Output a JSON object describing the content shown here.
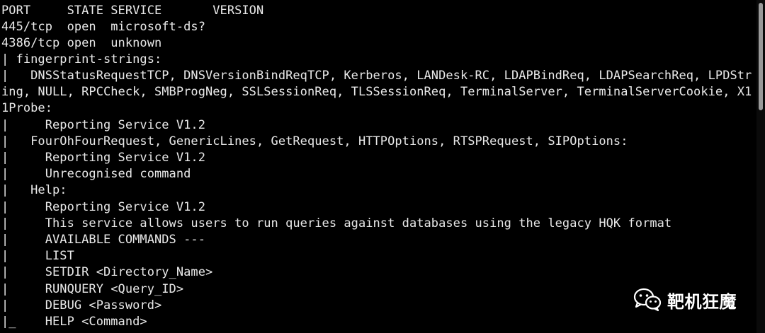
{
  "terminal": {
    "lines": [
      "PORT     STATE SERVICE       VERSION",
      "445/tcp  open  microsoft-ds?",
      "4386/tcp open  unknown",
      "| fingerprint-strings:",
      "|   DNSStatusRequestTCP, DNSVersionBindReqTCP, Kerberos, LANDesk-RC, LDAPBindReq, LDAPSearchReq, LPDStr",
      "ing, NULL, RPCCheck, SMBProgNeg, SSLSessionReq, TLSSessionReq, TerminalServer, TerminalServerCookie, X1",
      "1Probe:",
      "|     Reporting Service V1.2",
      "|   FourOhFourRequest, GenericLines, GetRequest, HTTPOptions, RTSPRequest, SIPOptions:",
      "|     Reporting Service V1.2",
      "|     Unrecognised command",
      "|   Help:",
      "|     Reporting Service V1.2",
      "|     This service allows users to run queries against databases using the legacy HQK format",
      "|     AVAILABLE COMMANDS ---",
      "|     LIST",
      "|     SETDIR <Directory_Name>",
      "|     RUNQUERY <Query_ID>",
      "|     DEBUG <Password>",
      "|_    HELP <Command>"
    ]
  },
  "watermark": {
    "icon": "wechat-icon",
    "text": "靶机狂魔"
  },
  "colors": {
    "background": "#000000",
    "text": "#e9e9e9",
    "scroll_thumb": "#9a9a9a"
  }
}
